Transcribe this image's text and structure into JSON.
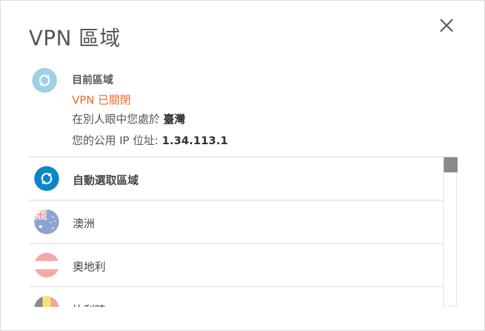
{
  "dialog": {
    "title": "VPN 區域",
    "close_icon": "close-icon"
  },
  "current": {
    "icon": "refresh-icon",
    "icon_color": "#9ed0e6",
    "label": "目前區域",
    "status": "VPN 已關閉",
    "status_color": "#f0692c",
    "seen_prefix": "在別人眼中您處於",
    "seen_location": "臺灣",
    "ip_prefix": "您的公用 IP 位址:",
    "ip_value": "1.34.113.1"
  },
  "regions": [
    {
      "label": "自動選取區域",
      "icon": "auto-select-icon",
      "bold": true
    },
    {
      "label": "澳洲",
      "icon": "australia-flag-icon"
    },
    {
      "label": "奧地利",
      "icon": "austria-flag-icon"
    },
    {
      "label": "比利時",
      "icon": "belgium-flag-icon"
    }
  ],
  "colors": {
    "accent_blue": "#0a86c8",
    "light_blue": "#9ed0e6"
  }
}
